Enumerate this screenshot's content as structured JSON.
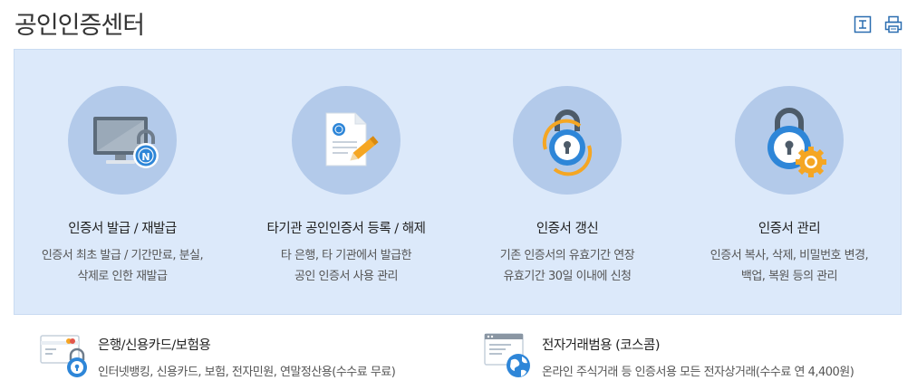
{
  "page": {
    "title": "공인인증센터"
  },
  "toolbar": {
    "download_icon": "download-icon",
    "print_icon": "print-icon"
  },
  "cards": [
    {
      "icon": "monitor-lock-icon",
      "title": "인증서 발급 / 재발급",
      "desc_line1": "인증서 최초 발급 / 기간만료, 분실,",
      "desc_line2": "삭제로 인한 재발급"
    },
    {
      "icon": "document-pen-icon",
      "title": "타기관 공인인증서 등록 / 해제",
      "desc_line1": "타 은행, 타 기관에서 발급한",
      "desc_line2": "공인 인증서 사용 관리"
    },
    {
      "icon": "lock-renew-icon",
      "title": "인증서 갱신",
      "desc_line1": "기존 인증서의 유효기간 연장",
      "desc_line2": "유효기간 30일 이내에 신청"
    },
    {
      "icon": "lock-gear-icon",
      "title": "인증서 관리",
      "desc_line1": "인증서 복사, 삭제, 비밀번호 변경,",
      "desc_line2": "백업, 복원 등의 관리"
    }
  ],
  "bottom": [
    {
      "icon": "card-lock-icon",
      "title": "은행/신용카드/보험용",
      "desc": "인터넷뱅킹, 신용카드, 보험, 전자민원, 연말정산용(수수료 무료)"
    },
    {
      "icon": "window-globe-icon",
      "title": "전자거래범용 (코스콤)",
      "desc": "온라인 주식거래 등 인증서용 모든 전자상거래(수수료 연 4,400원)"
    }
  ],
  "colors": {
    "panel_bg": "#dce9fa",
    "circle_bg": "#b3caea",
    "accent_blue": "#2e86d8",
    "accent_orange": "#f5a623"
  }
}
